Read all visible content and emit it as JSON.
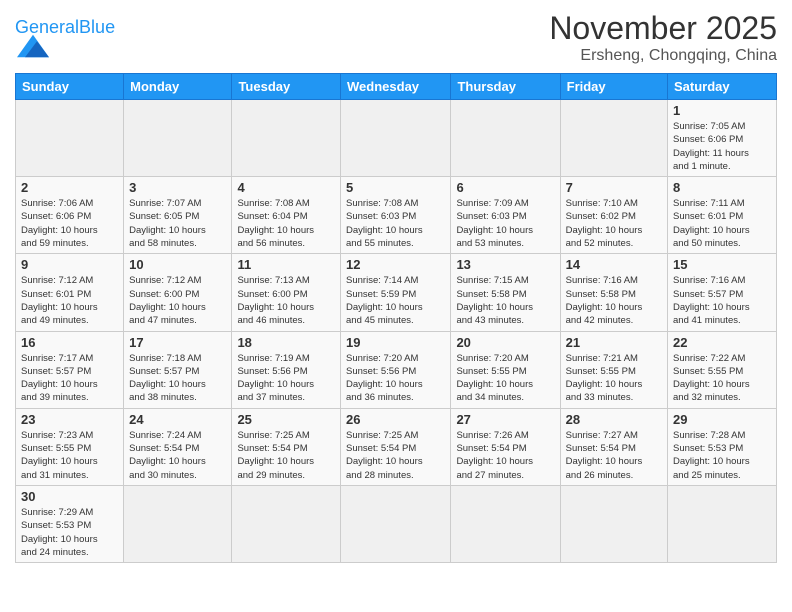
{
  "header": {
    "logo_general": "General",
    "logo_blue": "Blue",
    "month_title": "November 2025",
    "location": "Ersheng, Chongqing, China"
  },
  "days_of_week": [
    "Sunday",
    "Monday",
    "Tuesday",
    "Wednesday",
    "Thursday",
    "Friday",
    "Saturday"
  ],
  "weeks": [
    [
      {
        "day": "",
        "info": ""
      },
      {
        "day": "",
        "info": ""
      },
      {
        "day": "",
        "info": ""
      },
      {
        "day": "",
        "info": ""
      },
      {
        "day": "",
        "info": ""
      },
      {
        "day": "",
        "info": ""
      },
      {
        "day": "1",
        "info": "Sunrise: 7:05 AM\nSunset: 6:06 PM\nDaylight: 11 hours\nand 1 minute."
      }
    ],
    [
      {
        "day": "2",
        "info": "Sunrise: 7:06 AM\nSunset: 6:06 PM\nDaylight: 10 hours\nand 59 minutes."
      },
      {
        "day": "3",
        "info": "Sunrise: 7:07 AM\nSunset: 6:05 PM\nDaylight: 10 hours\nand 58 minutes."
      },
      {
        "day": "4",
        "info": "Sunrise: 7:08 AM\nSunset: 6:04 PM\nDaylight: 10 hours\nand 56 minutes."
      },
      {
        "day": "5",
        "info": "Sunrise: 7:08 AM\nSunset: 6:03 PM\nDaylight: 10 hours\nand 55 minutes."
      },
      {
        "day": "6",
        "info": "Sunrise: 7:09 AM\nSunset: 6:03 PM\nDaylight: 10 hours\nand 53 minutes."
      },
      {
        "day": "7",
        "info": "Sunrise: 7:10 AM\nSunset: 6:02 PM\nDaylight: 10 hours\nand 52 minutes."
      },
      {
        "day": "8",
        "info": "Sunrise: 7:11 AM\nSunset: 6:01 PM\nDaylight: 10 hours\nand 50 minutes."
      }
    ],
    [
      {
        "day": "9",
        "info": "Sunrise: 7:12 AM\nSunset: 6:01 PM\nDaylight: 10 hours\nand 49 minutes."
      },
      {
        "day": "10",
        "info": "Sunrise: 7:12 AM\nSunset: 6:00 PM\nDaylight: 10 hours\nand 47 minutes."
      },
      {
        "day": "11",
        "info": "Sunrise: 7:13 AM\nSunset: 6:00 PM\nDaylight: 10 hours\nand 46 minutes."
      },
      {
        "day": "12",
        "info": "Sunrise: 7:14 AM\nSunset: 5:59 PM\nDaylight: 10 hours\nand 45 minutes."
      },
      {
        "day": "13",
        "info": "Sunrise: 7:15 AM\nSunset: 5:58 PM\nDaylight: 10 hours\nand 43 minutes."
      },
      {
        "day": "14",
        "info": "Sunrise: 7:16 AM\nSunset: 5:58 PM\nDaylight: 10 hours\nand 42 minutes."
      },
      {
        "day": "15",
        "info": "Sunrise: 7:16 AM\nSunset: 5:57 PM\nDaylight: 10 hours\nand 41 minutes."
      }
    ],
    [
      {
        "day": "16",
        "info": "Sunrise: 7:17 AM\nSunset: 5:57 PM\nDaylight: 10 hours\nand 39 minutes."
      },
      {
        "day": "17",
        "info": "Sunrise: 7:18 AM\nSunset: 5:57 PM\nDaylight: 10 hours\nand 38 minutes."
      },
      {
        "day": "18",
        "info": "Sunrise: 7:19 AM\nSunset: 5:56 PM\nDaylight: 10 hours\nand 37 minutes."
      },
      {
        "day": "19",
        "info": "Sunrise: 7:20 AM\nSunset: 5:56 PM\nDaylight: 10 hours\nand 36 minutes."
      },
      {
        "day": "20",
        "info": "Sunrise: 7:20 AM\nSunset: 5:55 PM\nDaylight: 10 hours\nand 34 minutes."
      },
      {
        "day": "21",
        "info": "Sunrise: 7:21 AM\nSunset: 5:55 PM\nDaylight: 10 hours\nand 33 minutes."
      },
      {
        "day": "22",
        "info": "Sunrise: 7:22 AM\nSunset: 5:55 PM\nDaylight: 10 hours\nand 32 minutes."
      }
    ],
    [
      {
        "day": "23",
        "info": "Sunrise: 7:23 AM\nSunset: 5:55 PM\nDaylight: 10 hours\nand 31 minutes."
      },
      {
        "day": "24",
        "info": "Sunrise: 7:24 AM\nSunset: 5:54 PM\nDaylight: 10 hours\nand 30 minutes."
      },
      {
        "day": "25",
        "info": "Sunrise: 7:25 AM\nSunset: 5:54 PM\nDaylight: 10 hours\nand 29 minutes."
      },
      {
        "day": "26",
        "info": "Sunrise: 7:25 AM\nSunset: 5:54 PM\nDaylight: 10 hours\nand 28 minutes."
      },
      {
        "day": "27",
        "info": "Sunrise: 7:26 AM\nSunset: 5:54 PM\nDaylight: 10 hours\nand 27 minutes."
      },
      {
        "day": "28",
        "info": "Sunrise: 7:27 AM\nSunset: 5:54 PM\nDaylight: 10 hours\nand 26 minutes."
      },
      {
        "day": "29",
        "info": "Sunrise: 7:28 AM\nSunset: 5:53 PM\nDaylight: 10 hours\nand 25 minutes."
      }
    ],
    [
      {
        "day": "30",
        "info": "Sunrise: 7:29 AM\nSunset: 5:53 PM\nDaylight: 10 hours\nand 24 minutes."
      },
      {
        "day": "",
        "info": ""
      },
      {
        "day": "",
        "info": ""
      },
      {
        "day": "",
        "info": ""
      },
      {
        "day": "",
        "info": ""
      },
      {
        "day": "",
        "info": ""
      },
      {
        "day": "",
        "info": ""
      }
    ]
  ]
}
